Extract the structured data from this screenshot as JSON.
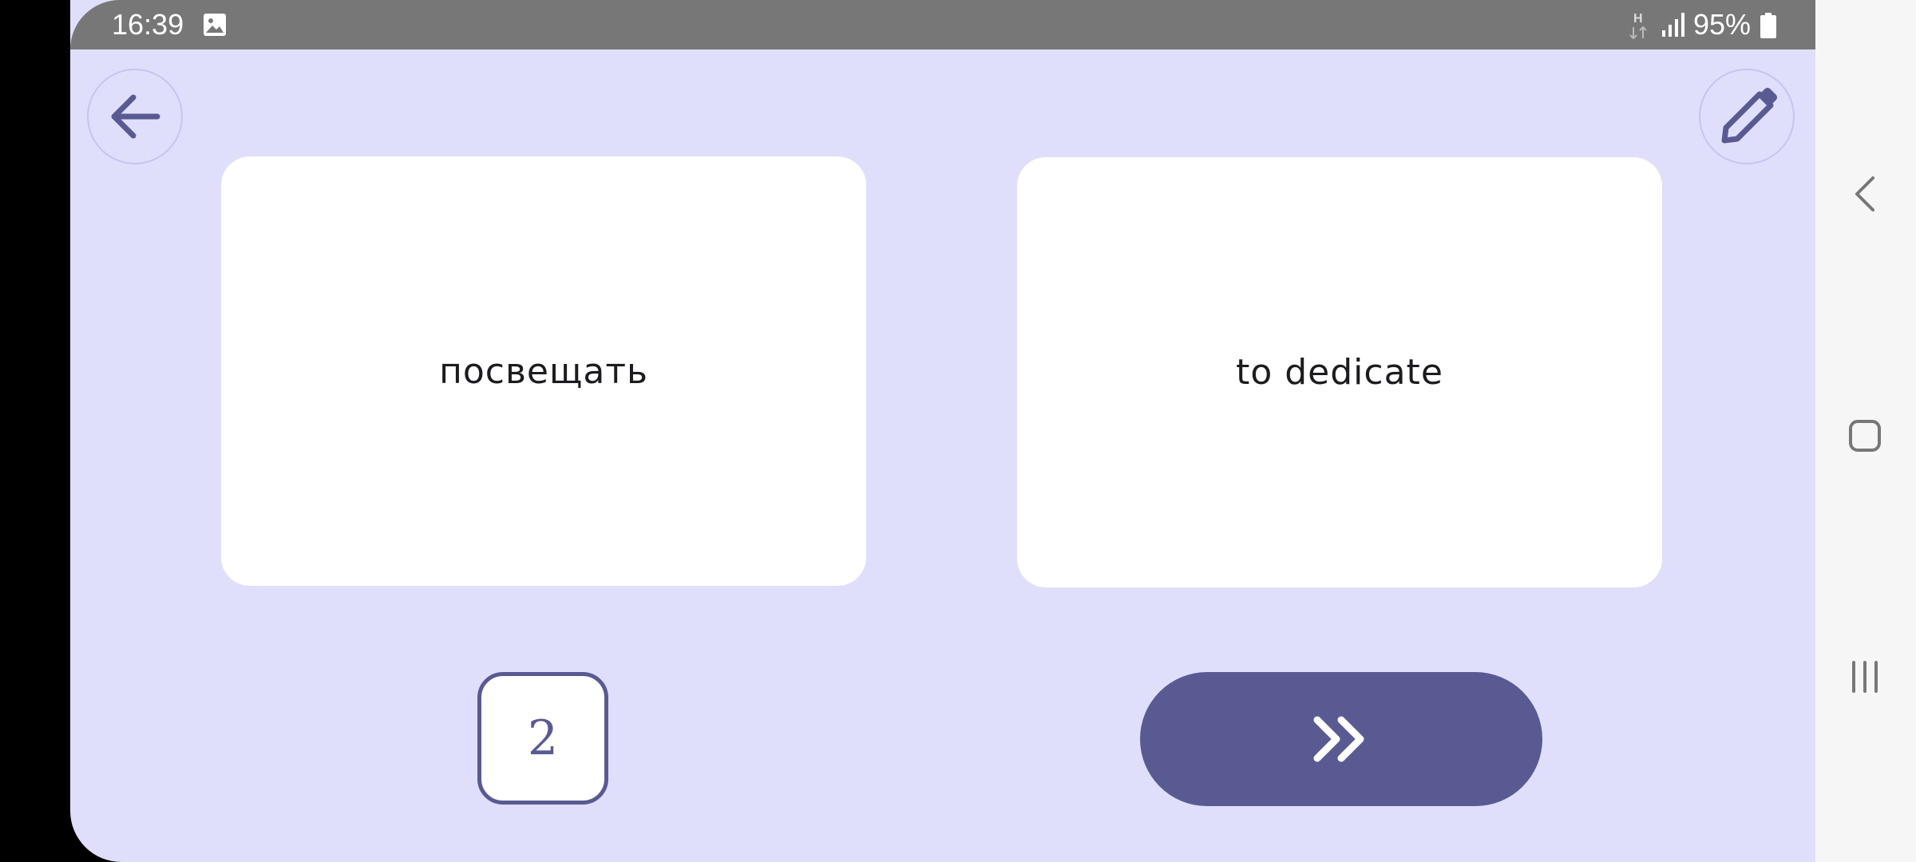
{
  "status_bar": {
    "time": "16:39",
    "network_type": "H",
    "battery": "95%",
    "icons": [
      "image-icon",
      "network-h-icon",
      "signal-icon",
      "battery-icon"
    ]
  },
  "toolbar": {
    "back_icon": "arrow-left-icon",
    "edit_icon": "pencil-icon"
  },
  "flashcard": {
    "front": "посвещать",
    "back": "to dedicate"
  },
  "counter": {
    "value": "2"
  },
  "next_button": {
    "icon": "double-chevron-right-icon"
  },
  "nav_bar": {
    "icons": [
      "nav-back-icon",
      "nav-home-icon",
      "nav-recents-icon"
    ]
  },
  "colors": {
    "background": "#dfdffc",
    "accent": "#5a5a93",
    "status_bar": "#777777",
    "card": "#ffffff"
  }
}
